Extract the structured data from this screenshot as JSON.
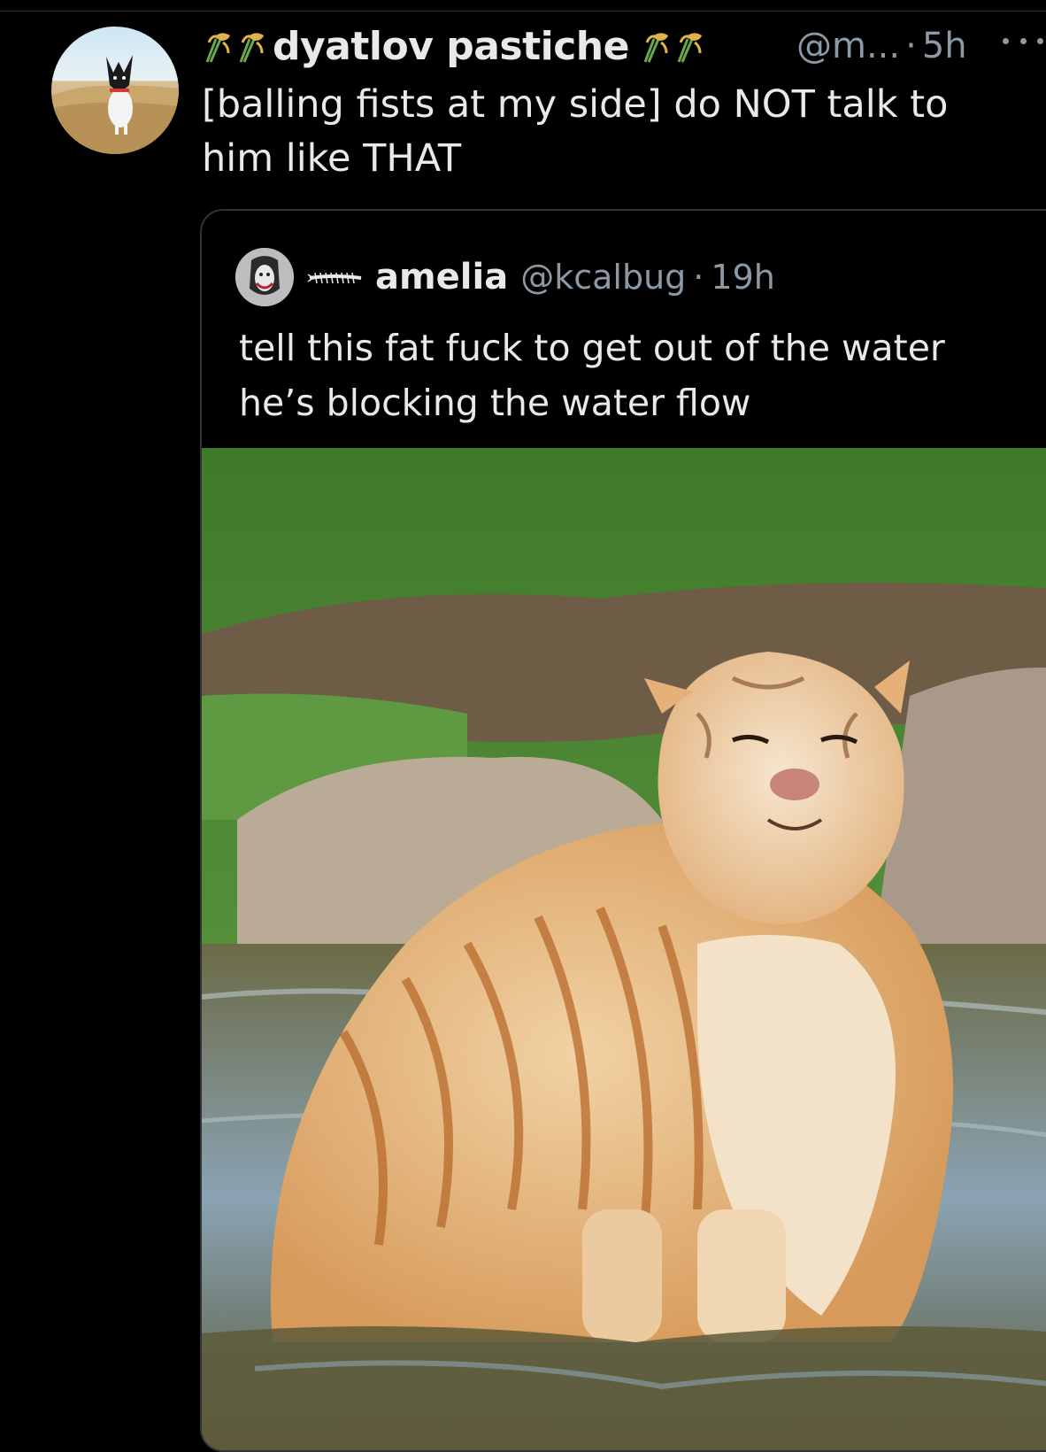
{
  "tweet": {
    "display_name": "dyatlov pastiche",
    "handle": "@m...",
    "separator": "·",
    "time": "5h",
    "text": "[balling fists at my side] do NOT talk to him like THAT",
    "name_emoji": "rice-sheaf-icon"
  },
  "quoted_tweet": {
    "display_name": "amelia",
    "handle": "@kcalbug",
    "separator": "·",
    "time": "19h",
    "text": "tell this fat fuck to get out of the water he’s blocking the water flow",
    "name_emoji": "centipede-icon",
    "image_description_icon": "tiger-photo"
  },
  "colors": {
    "background": "#000000",
    "text": "#e7e9ea",
    "secondary_text": "#8b98a5",
    "border": "#2f3336"
  }
}
